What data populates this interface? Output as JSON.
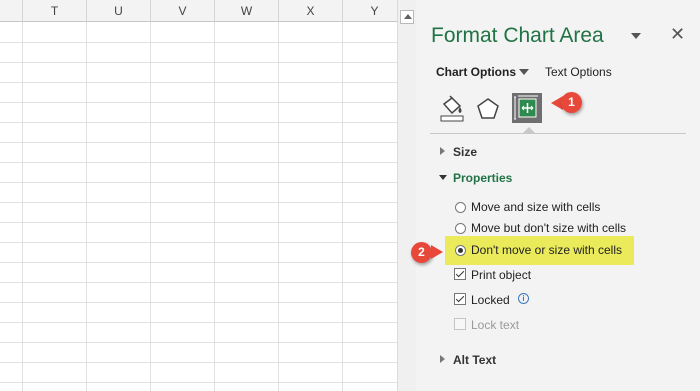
{
  "spreadsheet": {
    "columns": [
      "T",
      "U",
      "V",
      "W",
      "X",
      "Y"
    ]
  },
  "pane": {
    "title": "Format Chart Area",
    "close_glyph": "✕",
    "chart_options_label": "Chart Options",
    "text_options_label": "Text Options",
    "tabs": [
      {
        "icon": "paint-bucket-icon"
      },
      {
        "icon": "pentagon-icon"
      },
      {
        "icon": "size-properties-icon"
      }
    ],
    "sections": {
      "size": {
        "label": "Size"
      },
      "properties": {
        "label": "Properties"
      },
      "alt_text": {
        "label": "Alt Text"
      }
    },
    "placement_options": [
      {
        "label": "Move and size with cells",
        "selected": false
      },
      {
        "label": "Move but don't size with cells",
        "selected": false
      },
      {
        "label": "Don't move or size with cells",
        "selected": true
      }
    ],
    "checkboxes": [
      {
        "label": "Print object",
        "checked": true,
        "enabled": true
      },
      {
        "label": "Locked",
        "checked": true,
        "enabled": true
      },
      {
        "label": "Lock text",
        "checked": false,
        "enabled": false
      }
    ]
  },
  "callouts": [
    "1",
    "2"
  ],
  "colors": {
    "accent_green": "#217346",
    "callout_red": "#e8483a",
    "highlight_yellow": "#eaea5a",
    "pane_background": "#f3f3f3"
  }
}
